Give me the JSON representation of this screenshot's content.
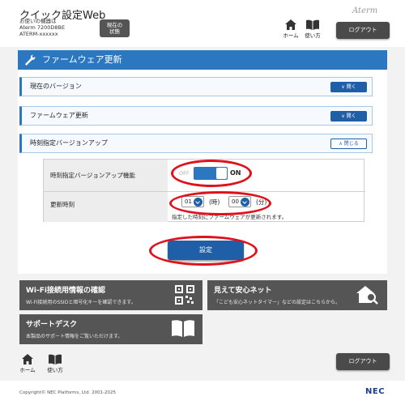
{
  "header": {
    "app_title": "クイック設定Web",
    "device_label": "お使いの機器は",
    "device_model": "Aterm 7200D8BE",
    "device_id": "ATERM-xxxxxx",
    "status_button_line1": "現在の",
    "status_button_line2": "状態",
    "logo": "Aterm",
    "nav_home": "ホーム",
    "nav_help": "使い方",
    "logout": "ログアウト"
  },
  "section": {
    "title": "ファームウェア更新",
    "accordions": [
      {
        "label": "現在のバージョン",
        "button": "開く"
      },
      {
        "label": "ファームウェア更新",
        "button": "開く"
      },
      {
        "label": "時刻指定バージョンアップ",
        "button": "閉じる"
      }
    ],
    "auto_update": {
      "label": "時刻指定バージョンアップ機能",
      "off_text": "OFF",
      "on_text": "ON",
      "state": "on"
    },
    "update_time": {
      "label": "更新時刻",
      "hour_value": "01",
      "hour_unit": "(時)",
      "minute_value": "00",
      "minute_unit": "(分)",
      "note": "指定した時刻にファームウェアが更新されます。"
    },
    "save_button": "設定"
  },
  "tiles": [
    {
      "title": "Wi-Fi接続用情報の確認",
      "desc": "Wi-Fi接続用のSSIDと暗号化キーを確認できます。",
      "icon": "qr-code-icon"
    },
    {
      "title": "見えて安心ネット",
      "desc": "「こども安心ネットタイマー」などの設定はこちらから。",
      "icon": "home-search-icon"
    },
    {
      "title": "サポートデスク",
      "desc": "本製品のサポート情報をご覧いただけます。",
      "icon": "book-icon"
    }
  ],
  "footer": {
    "nav_home": "ホーム",
    "nav_help": "使い方",
    "logout": "ログアウト",
    "copyright": "Copyright© NEC Platforms, Ltd. 2001-2025",
    "brand": "NEC"
  },
  "colors": {
    "accent": "#2b78c0",
    "highlight": "#e0111b",
    "tile": "#555555"
  }
}
